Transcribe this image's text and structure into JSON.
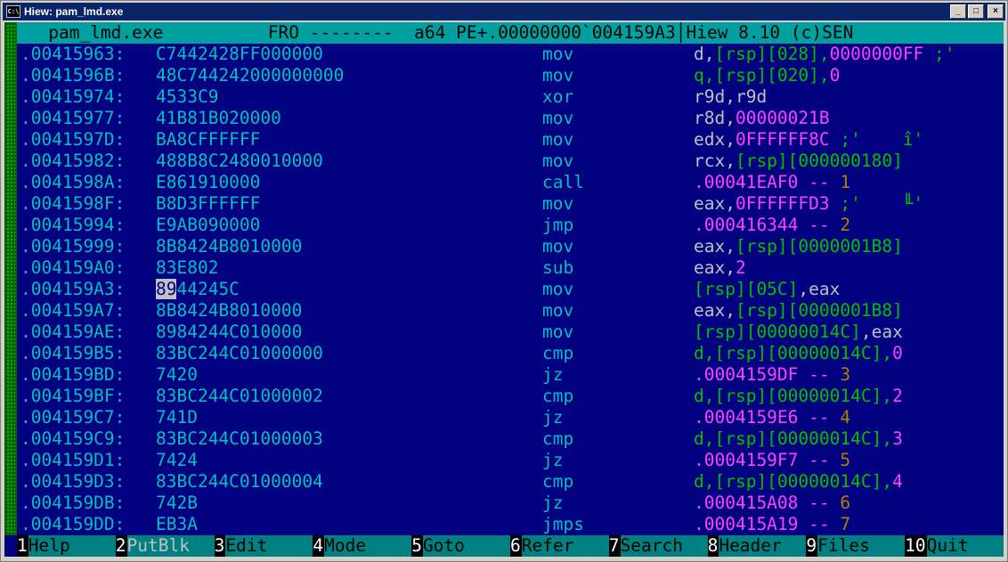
{
  "window": {
    "title": "Hiew: pam_lmd.exe",
    "icon_text": "C:\\",
    "buttons": [
      "_",
      "□",
      "×"
    ]
  },
  "status": {
    "filename": "pam_lmd.exe",
    "mode": "FRO",
    "dashes": "--------",
    "arch": "a64",
    "format": "PE+",
    "address": ".00000000`004159A3",
    "app": "Hiew 8.10 (c)SEN"
  },
  "lines": [
    {
      "addr": ".00415963:",
      "hex": "C7442428FF000000",
      "mn": "mov",
      "ops": [
        [
          "d,",
          "w"
        ],
        [
          "[rsp][028]",
          "g"
        ],
        [
          ",",
          "g"
        ],
        [
          "0000000FF",
          "m"
        ],
        [
          " ;'",
          "g"
        ]
      ]
    },
    {
      "addr": ".0041596B:",
      "hex": "48C744242000000000",
      "mn": "mov",
      "ops": [
        [
          "q,",
          "g"
        ],
        [
          "[rsp][020]",
          "g"
        ],
        [
          ",",
          "g"
        ],
        [
          "0",
          "m"
        ]
      ]
    },
    {
      "addr": ".00415974:",
      "hex": "4533C9",
      "mn": "xor",
      "ops": [
        [
          "r9d,r9d",
          "w"
        ]
      ]
    },
    {
      "addr": ".00415977:",
      "hex": "41B81B020000",
      "mn": "mov",
      "ops": [
        [
          "r8d,",
          "w"
        ],
        [
          "00000021B",
          "m"
        ]
      ]
    },
    {
      "addr": ".0041597D:",
      "hex": "BA8CFFFFFF",
      "mn": "mov",
      "ops": [
        [
          "edx,",
          "w"
        ],
        [
          "0FFFFFF8C",
          "m"
        ],
        [
          " ;'    î'",
          "g"
        ]
      ]
    },
    {
      "addr": ".00415982:",
      "hex": "488B8C2480010000",
      "mn": "mov",
      "ops": [
        [
          "rcx,",
          "w"
        ],
        [
          "[rsp][000000180]",
          "g"
        ]
      ]
    },
    {
      "addr": ".0041598A:",
      "hex": "E861910000",
      "mn": "call",
      "ops": [
        [
          ".00041EAF0",
          "m"
        ],
        [
          " -- ",
          "m"
        ],
        [
          "1",
          "y"
        ]
      ]
    },
    {
      "addr": ".0041598F:",
      "hex": "B8D3FFFFFF",
      "mn": "mov",
      "ops": [
        [
          "eax,",
          "w"
        ],
        [
          "0FFFFFFD3",
          "m"
        ],
        [
          " ;'    ╙'",
          "g"
        ]
      ]
    },
    {
      "addr": ".00415994:",
      "hex": "E9AB090000",
      "mn": "jmp",
      "ops": [
        [
          ".000416344",
          "m"
        ],
        [
          " -- ",
          "m"
        ],
        [
          "2",
          "y"
        ]
      ]
    },
    {
      "addr": ".00415999:",
      "hex": "8B8424B8010000",
      "mn": "mov",
      "ops": [
        [
          "eax,",
          "w"
        ],
        [
          "[rsp][0000001B8]",
          "g"
        ]
      ]
    },
    {
      "addr": ".004159A0:",
      "hex": "83E802",
      "mn": "sub",
      "ops": [
        [
          "eax,",
          "w"
        ],
        [
          "2",
          "m"
        ]
      ]
    },
    {
      "addr": ".004159A3:",
      "hex_cur": "89",
      "hex": "44245C",
      "mn": "mov",
      "ops": [
        [
          "[rsp][05C]",
          "g"
        ],
        [
          ",eax",
          "w"
        ]
      ]
    },
    {
      "addr": ".004159A7:",
      "hex": "8B8424B8010000",
      "mn": "mov",
      "ops": [
        [
          "eax,",
          "w"
        ],
        [
          "[rsp][0000001B8]",
          "g"
        ]
      ]
    },
    {
      "addr": ".004159AE:",
      "hex": "8984244C010000",
      "mn": "mov",
      "ops": [
        [
          "[rsp][00000014C]",
          "g"
        ],
        [
          ",eax",
          "w"
        ]
      ]
    },
    {
      "addr": ".004159B5:",
      "hex": "83BC244C01000000",
      "mn": "cmp",
      "ops": [
        [
          "d,",
          "g"
        ],
        [
          "[rsp][00000014C]",
          "g"
        ],
        [
          ",",
          "g"
        ],
        [
          "0",
          "m"
        ]
      ]
    },
    {
      "addr": ".004159BD:",
      "hex": "7420",
      "mn": "jz",
      "ops": [
        [
          ".0004159DF",
          "m"
        ],
        [
          " -- ",
          "m"
        ],
        [
          "3",
          "y"
        ]
      ]
    },
    {
      "addr": ".004159BF:",
      "hex": "83BC244C01000002",
      "mn": "cmp",
      "ops": [
        [
          "d,",
          "g"
        ],
        [
          "[rsp][00000014C]",
          "g"
        ],
        [
          ",",
          "g"
        ],
        [
          "2",
          "m"
        ]
      ]
    },
    {
      "addr": ".004159C7:",
      "hex": "741D",
      "mn": "jz",
      "ops": [
        [
          ".0004159E6",
          "m"
        ],
        [
          " -- ",
          "m"
        ],
        [
          "4",
          "y"
        ]
      ]
    },
    {
      "addr": ".004159C9:",
      "hex": "83BC244C01000003",
      "mn": "cmp",
      "ops": [
        [
          "d,",
          "g"
        ],
        [
          "[rsp][00000014C]",
          "g"
        ],
        [
          ",",
          "g"
        ],
        [
          "3",
          "m"
        ]
      ]
    },
    {
      "addr": ".004159D1:",
      "hex": "7424",
      "mn": "jz",
      "ops": [
        [
          ".0004159F7",
          "m"
        ],
        [
          " -- ",
          "m"
        ],
        [
          "5",
          "y"
        ]
      ]
    },
    {
      "addr": ".004159D3:",
      "hex": "83BC244C01000004",
      "mn": "cmp",
      "ops": [
        [
          "d,",
          "g"
        ],
        [
          "[rsp][00000014C]",
          "g"
        ],
        [
          ",",
          "g"
        ],
        [
          "4",
          "m"
        ]
      ]
    },
    {
      "addr": ".004159DB:",
      "hex": "742B",
      "mn": "jz",
      "ops": [
        [
          ".000415A08",
          "m"
        ],
        [
          " -- ",
          "m"
        ],
        [
          "6",
          "y"
        ]
      ]
    },
    {
      "addr": ".004159DD:",
      "hex": "EB3A",
      "mn": "jmps",
      "ops": [
        [
          ".000415A19",
          "m"
        ],
        [
          " -- ",
          "m"
        ],
        [
          "7",
          "y"
        ]
      ]
    }
  ],
  "fkeys": [
    {
      "num": "1",
      "label": "Help"
    },
    {
      "num": "2",
      "label": "PutBlk",
      "hl": true
    },
    {
      "num": "3",
      "label": "Edit"
    },
    {
      "num": "4",
      "label": "Mode"
    },
    {
      "num": "5",
      "label": "Goto"
    },
    {
      "num": "6",
      "label": "Refer"
    },
    {
      "num": "7",
      "label": "Search"
    },
    {
      "num": "8",
      "label": "Header"
    },
    {
      "num": "9",
      "label": "Files"
    },
    {
      "num": "10",
      "label": "Quit"
    }
  ],
  "colors": {
    "background": "#000080",
    "status_bar": "#00a0a0",
    "address": "#00c0c0",
    "operand_green": "#00c000",
    "immediate_magenta": "#ff40ff",
    "reference_number": "#b08000"
  }
}
